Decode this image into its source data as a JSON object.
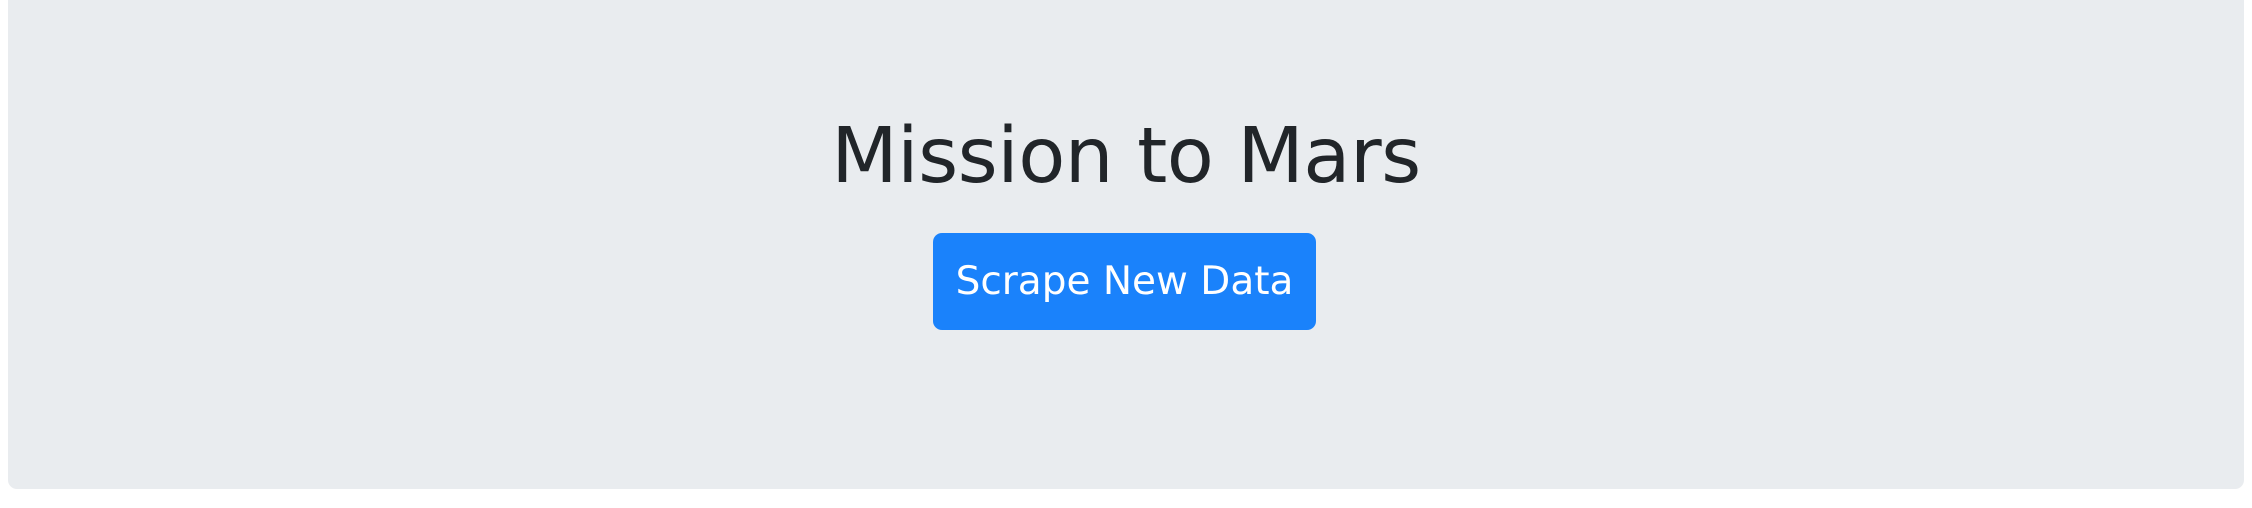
{
  "header": {
    "title": "Mission to Mars",
    "scrape_button_label": "Scrape New Data"
  },
  "colors": {
    "jumbotron_background": "#e9ecef",
    "title_text": "#212529",
    "button_primary": "#1a82fb",
    "button_text": "#ffffff"
  }
}
